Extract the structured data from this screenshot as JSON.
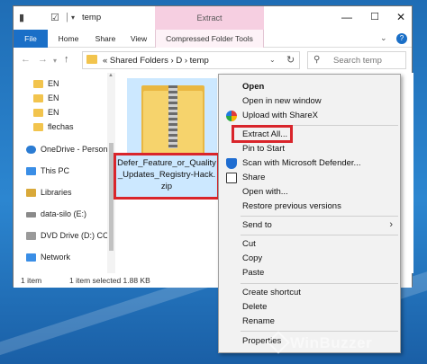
{
  "window": {
    "title": "temp",
    "extract_tab": "Extract",
    "controls": {
      "minimize": "—",
      "maximize": "☐",
      "close": "✕"
    }
  },
  "ribbon": {
    "tabs": [
      "File",
      "Home",
      "Share",
      "View",
      "Compressed Folder Tools"
    ],
    "expand": "⌄",
    "help": "?"
  },
  "address": {
    "path": "«  Shared Folders  ›  D  ›  temp",
    "search_placeholder": "Search temp"
  },
  "sidebar": {
    "items": [
      {
        "label": "EN",
        "icon": "folder-icon"
      },
      {
        "label": "EN",
        "icon": "folder-icon"
      },
      {
        "label": "EN",
        "icon": "folder-icon"
      },
      {
        "label": "flechas",
        "icon": "folder-icon"
      },
      {
        "label": "OneDrive - Person",
        "icon": "onedrive-icon"
      },
      {
        "label": "This PC",
        "icon": "pc-icon"
      },
      {
        "label": "Libraries",
        "icon": "library-icon"
      },
      {
        "label": "data-silo (E:)",
        "icon": "drive-icon"
      },
      {
        "label": "DVD Drive (D:) CC",
        "icon": "dvd-icon"
      },
      {
        "label": "Network",
        "icon": "network-icon"
      }
    ]
  },
  "content": {
    "file_name": "Defer_Feature_or_Quality_Updates_Registry-Hack.zip",
    "file_name_lines": [
      "Defer_Feature_or_Quality",
      "_Updates_Registry-Hack.",
      "zip"
    ]
  },
  "status": {
    "items": "1 item",
    "selected": "1 item selected  1.88 KB"
  },
  "context_menu": {
    "items": [
      {
        "label": "Open",
        "bold": true
      },
      {
        "label": "Open in new window"
      },
      {
        "label": "Upload with ShareX",
        "icon": "sharex-icon"
      },
      {
        "label": "Extract All..."
      },
      {
        "label": "Pin to Start"
      },
      {
        "label": "Scan with Microsoft Defender...",
        "icon": "defender-shield-icon"
      },
      {
        "label": "Share",
        "icon": "share-icon"
      },
      {
        "label": "Open with..."
      },
      {
        "label": "Restore previous versions"
      },
      {
        "label": "Send to",
        "submenu": true
      },
      {
        "label": "Cut"
      },
      {
        "label": "Copy"
      },
      {
        "label": "Paste"
      },
      {
        "label": "Create shortcut"
      },
      {
        "label": "Delete"
      },
      {
        "label": "Rename"
      },
      {
        "label": "Properties"
      }
    ]
  },
  "watermark": "WinBuzzer",
  "colors": {
    "accent_blue": "#1a6fc7",
    "extract_tab": "#f6cfe1",
    "highlight_red": "#d9252b",
    "selection": "#cce8ff"
  }
}
